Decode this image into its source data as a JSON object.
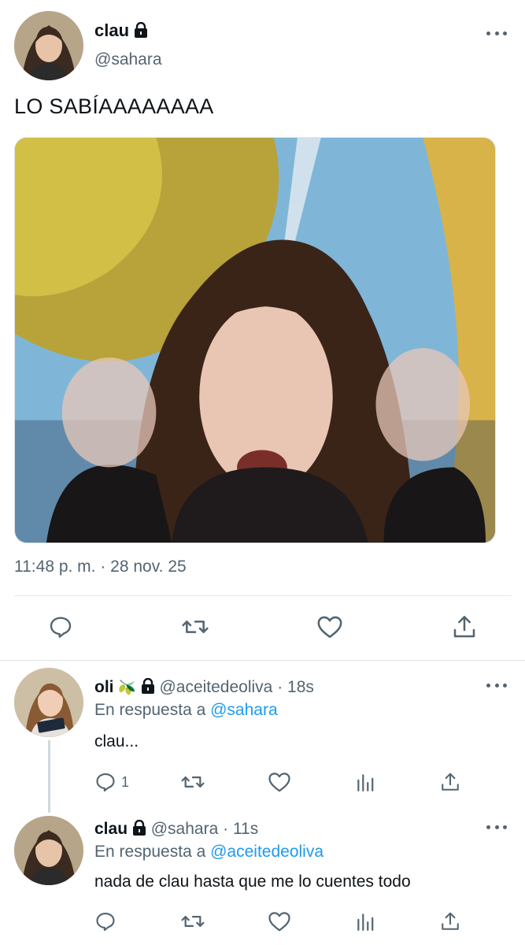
{
  "main_tweet": {
    "display_name": "clau",
    "handle": "@sahara",
    "text": "LO SABÍAAAAAAAA",
    "timestamp": "11:48 p. m. · 28 nov. 25",
    "actions": [
      "reply-icon",
      "retweet-icon",
      "like-icon",
      "share-icon"
    ]
  },
  "replies": [
    {
      "display_name": "oli",
      "emoji": "🫒",
      "handle": "@aceitedeoliva",
      "separator": "·",
      "time": "18s",
      "reply_prefix": "En respuesta a",
      "reply_to": "@sahara",
      "text": "clau...",
      "reply_count": "1"
    },
    {
      "display_name": "clau",
      "handle": "@sahara",
      "separator": "·",
      "time": "11s",
      "reply_prefix": "En respuesta a",
      "reply_to": "@aceitedeoliva",
      "text": "nada de clau hasta que me lo cuentes todo",
      "reply_count": ""
    }
  ],
  "colors": {
    "text": "#0f1419",
    "muted": "#536471",
    "link": "#1d9bf0",
    "divider": "#e3e6ea"
  }
}
